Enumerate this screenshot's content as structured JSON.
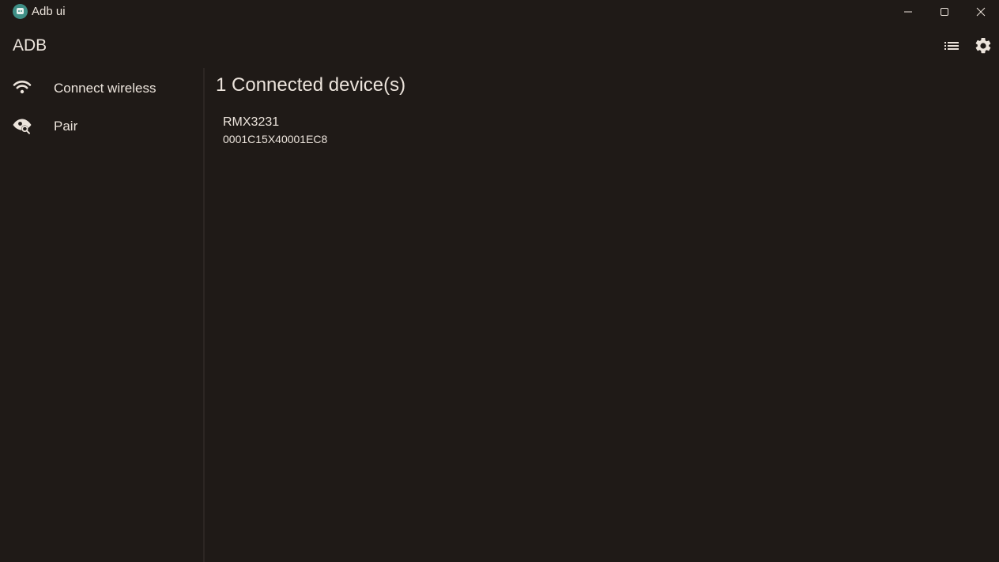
{
  "window": {
    "title": "Adb ui"
  },
  "app_bar": {
    "title": "ADB",
    "actions": [
      {
        "icon": "list-view-icon"
      },
      {
        "icon": "gear-icon"
      }
    ]
  },
  "sidebar": {
    "items": [
      {
        "label": "Connect wireless",
        "icon": "wifi-icon"
      },
      {
        "label": "Pair",
        "icon": "pair-eye-icon"
      }
    ]
  },
  "main": {
    "heading": "1 Connected device(s)",
    "devices": [
      {
        "name": "RMX3231",
        "serial": "0001C15X40001EC8"
      }
    ]
  },
  "colors": {
    "background": "#1f1a17",
    "text": "#ece4dc",
    "accent_logo": "#3f8f86",
    "divider": "#2c2623"
  }
}
